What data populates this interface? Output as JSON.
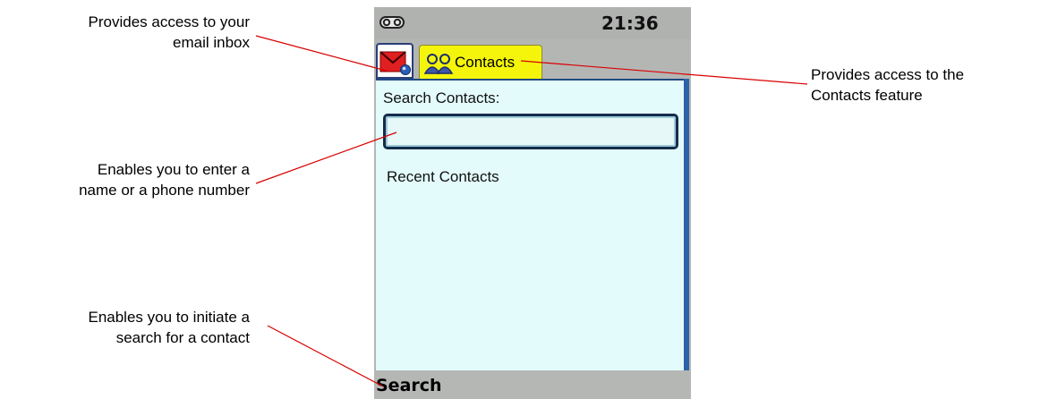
{
  "callouts": {
    "inbox": {
      "line1": "Provides access to your",
      "line2": "email inbox"
    },
    "entry": {
      "line1": "Enables you to enter a",
      "line2": "name or a phone number"
    },
    "search": {
      "line1": "Enables you to initiate a",
      "line2": "search for a contact"
    },
    "contacts": {
      "line1": "Provides access to the",
      "line2": "Contacts feature"
    }
  },
  "phone": {
    "status": {
      "time": "21:36",
      "signal_icon": "signal-icon"
    },
    "tabs": [
      {
        "icon": "email-icon",
        "label": ""
      },
      {
        "icon": "contacts-icon",
        "label": "Contacts"
      }
    ],
    "search_label": "Search Contacts:",
    "search_input": {
      "value": "",
      "placeholder": ""
    },
    "recent_label": "Recent Contacts",
    "softkey": {
      "left_label": "Search"
    }
  },
  "colors": {
    "callout_line": "#d90000",
    "tab_active": "#f5f50c",
    "content_bg": "#e4fbfb",
    "phone_frame": "#b4b6b4"
  }
}
